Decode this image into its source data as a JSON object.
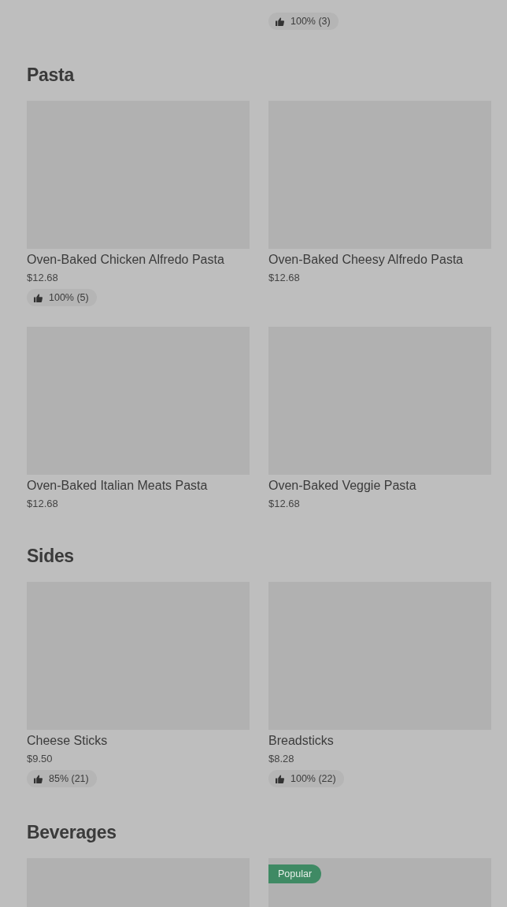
{
  "top_partial": {
    "rating": "100% (3)"
  },
  "sections": [
    {
      "title": "Pasta",
      "items": [
        {
          "kind": "dish",
          "name": "Oven-Baked Chicken Alfredo Pasta",
          "price": "$12.68",
          "rating": "100% (5)"
        },
        {
          "kind": "dish",
          "name": "Oven-Baked Cheesy Alfredo Pasta",
          "price": "$12.68"
        },
        {
          "kind": "dish",
          "name": "Oven-Baked Italian Meats Pasta",
          "price": "$12.68"
        },
        {
          "kind": "dish",
          "name": "Oven-Baked Veggie Pasta",
          "price": "$12.68"
        }
      ]
    },
    {
      "title": "Sides",
      "items": [
        {
          "kind": "dish",
          "name": "Cheese Sticks",
          "price": "$9.50",
          "rating": "85% (21)"
        },
        {
          "kind": "dish",
          "name": "Breadsticks",
          "price": "$8.28",
          "rating": "100% (22)"
        }
      ]
    },
    {
      "title": "Beverages",
      "items": [
        {
          "kind": "picture-only"
        },
        {
          "kind": "picture-only",
          "badge": "Popular"
        }
      ]
    }
  ]
}
